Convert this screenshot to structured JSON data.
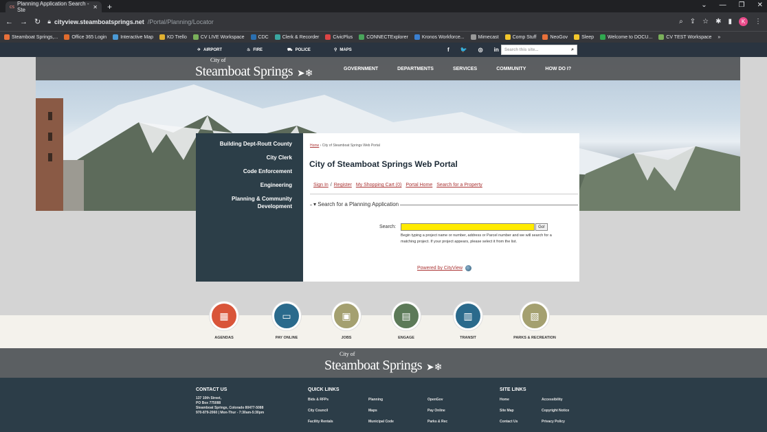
{
  "browser": {
    "tab_title": "Planning Application Search - Ste",
    "tab_favicon": "cs",
    "new_tab": "+",
    "url_domain": "cityview.steamboatsprings.net",
    "url_path": "/Portal/Planning/Locator",
    "bookmarks": [
      {
        "label": "Steamboat Springs,...",
        "color": "#e8703a"
      },
      {
        "label": "Office 365 Login",
        "color": "#e06b2d"
      },
      {
        "label": "Interactive Map",
        "color": "#4a9ad6"
      },
      {
        "label": "KD Trello",
        "color": "#e0b030"
      },
      {
        "label": "CV LIVE Workspace",
        "color": "#7ab05a"
      },
      {
        "label": "CDC",
        "color": "#2a6fb0"
      },
      {
        "label": "Clerk & Recorder",
        "color": "#3aa6a0"
      },
      {
        "label": "CivicPlus",
        "color": "#d44"
      },
      {
        "label": "CONNECTExplorer",
        "color": "#49a55b"
      },
      {
        "label": "Kronos Workforce...",
        "color": "#3a7fd0"
      },
      {
        "label": "Mimecast",
        "color": "#999"
      },
      {
        "label": "Comp Stuff",
        "color": "#f2c62b"
      },
      {
        "label": "NeoGov",
        "color": "#e8703a"
      },
      {
        "label": "Sleep",
        "color": "#f2c62b"
      },
      {
        "label": "Welcome to DOCU...",
        "color": "#2fa84f"
      },
      {
        "label": "CV TEST Workspace",
        "color": "#7ab05a"
      }
    ],
    "bookmarks_more": "»",
    "avatar_letter": "K"
  },
  "utility": {
    "airport": "AIRPORT",
    "fire": "FIRE",
    "police": "POLICE",
    "maps": "MAPS",
    "social": [
      "f",
      "🐦",
      "◎",
      "in"
    ],
    "search_placeholder": "Search this site..."
  },
  "logo": {
    "city_of": "City of",
    "name": "Steamboat Springs"
  },
  "nav": [
    "GOVERNMENT",
    "DEPARTMENTS",
    "SERVICES",
    "COMMUNITY",
    "HOW DO I?"
  ],
  "sidebar": [
    "Building Dept-Routt County",
    "City Clerk",
    "Code Enforcement",
    "Engineering",
    "Planning & Community Development"
  ],
  "portal": {
    "breadcrumb_home": "Home",
    "breadcrumb_sep": "›",
    "breadcrumb_current": "City of Steamboat Springs Web Portal",
    "title": "City of Steamboat Springs Web Portal",
    "link_signin": "Sign In",
    "link_sep": "/",
    "link_register": "Register",
    "link_cart": "My Shopping Cart (0)",
    "link_home": "Portal Home",
    "link_property": "Search for a Property",
    "legend": "▾ Search for a Planning Application",
    "search_label": "Search:",
    "go": "Go!",
    "help": "Begin typing a project name or number, address or Parcel number and we will search for a matching project. If your project appears, please select it from the list.",
    "powered": "Powered by CityView"
  },
  "quick_links": [
    {
      "label": "AGENDAS",
      "color": "#d9553a",
      "icon": "book-icon",
      "glyph": "▦"
    },
    {
      "label": "PAY ONLINE",
      "color": "#2a6a8c",
      "icon": "monitor-icon",
      "glyph": "▭"
    },
    {
      "label": "JOBS",
      "color": "#a4a070",
      "icon": "briefcase-icon",
      "glyph": "▣"
    },
    {
      "label": "ENGAGE",
      "color": "#5c7a58",
      "icon": "speech-icon",
      "glyph": "▤"
    },
    {
      "label": "TRANSIT",
      "color": "#2a6a8c",
      "icon": "bus-icon",
      "glyph": "▥"
    },
    {
      "label": "PARKS & RECREATION",
      "color": "#a4a070",
      "icon": "park-icon",
      "glyph": "▧"
    }
  ],
  "footer": {
    "contact_heading": "CONTACT US",
    "contact_lines": [
      "137 10th Street,",
      "PO Box 775088",
      "Steamboat Springs, Colorado 80477-5088",
      "970-879-2060 | Mon-Thur - 7:30am-5:30pm"
    ],
    "quick_heading": "QUICK LINKS",
    "quick_col1": [
      "Bids & RFPs",
      "City Council",
      "Facility Rentals"
    ],
    "quick_col2": [
      "Planning",
      "Maps",
      "Municipal Code"
    ],
    "quick_col3": [
      "OpenGov",
      "Pay Online",
      "Parks & Rec"
    ],
    "site_heading": "SITE LINKS",
    "site_col1": [
      "Home",
      "Site Map",
      "Contact Us"
    ],
    "site_col2": [
      "Accessibility",
      "Copyright Notice",
      "Privacy Policy"
    ]
  }
}
